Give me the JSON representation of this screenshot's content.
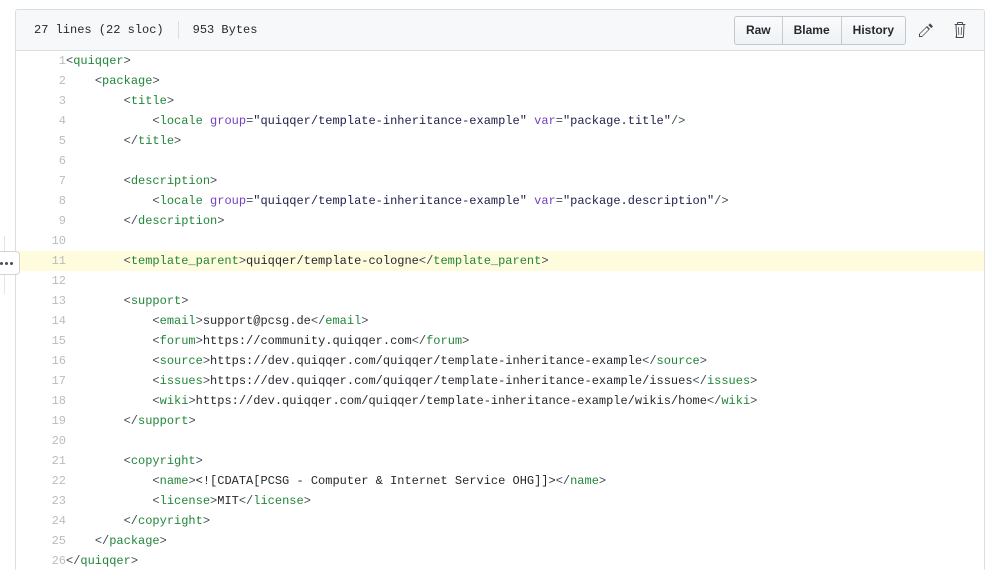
{
  "header": {
    "lines_info": "27 lines (22 sloc)",
    "size": "953 Bytes",
    "buttons": [
      {
        "label": "Raw",
        "name": "raw-button"
      },
      {
        "label": "Blame",
        "name": "blame-button"
      },
      {
        "label": "History",
        "name": "history-button"
      }
    ],
    "edit_icon": "pencil-icon",
    "delete_icon": "trash-icon"
  },
  "gutter_marker": {
    "icon": "kebab-dots-icon",
    "at_line": 11
  },
  "colors": {
    "tag": "#22863a",
    "attribute": "#6f42c1",
    "string": "#20224d",
    "bracket": "#3f4c55",
    "line_number": "#b9bdc2",
    "highlight": "#fffbdd",
    "header_bg": "#f6f8fa",
    "border": "#d8dee2"
  },
  "code": {
    "language": "xml",
    "highlighted_line": 11,
    "lines": [
      {
        "n": 1,
        "tokens": [
          {
            "t": "b",
            "v": "<"
          },
          {
            "t": "g",
            "v": "quiqqer"
          },
          {
            "t": "b",
            "v": ">"
          }
        ]
      },
      {
        "n": 2,
        "tokens": [
          {
            "t": "x",
            "v": "    "
          },
          {
            "t": "b",
            "v": "<"
          },
          {
            "t": "g",
            "v": "package"
          },
          {
            "t": "b",
            "v": ">"
          }
        ]
      },
      {
        "n": 3,
        "tokens": [
          {
            "t": "x",
            "v": "        "
          },
          {
            "t": "b",
            "v": "<"
          },
          {
            "t": "g",
            "v": "title"
          },
          {
            "t": "b",
            "v": ">"
          }
        ]
      },
      {
        "n": 4,
        "tokens": [
          {
            "t": "x",
            "v": "            "
          },
          {
            "t": "b",
            "v": "<"
          },
          {
            "t": "g",
            "v": "locale"
          },
          {
            "t": "x",
            "v": " "
          },
          {
            "t": "a",
            "v": "group"
          },
          {
            "t": "b",
            "v": "="
          },
          {
            "t": "s",
            "v": "\"quiqqer/template-inheritance-example\""
          },
          {
            "t": "x",
            "v": " "
          },
          {
            "t": "a",
            "v": "var"
          },
          {
            "t": "b",
            "v": "="
          },
          {
            "t": "s",
            "v": "\"package.title\""
          },
          {
            "t": "b",
            "v": "/>"
          }
        ]
      },
      {
        "n": 5,
        "tokens": [
          {
            "t": "x",
            "v": "        "
          },
          {
            "t": "b",
            "v": "</"
          },
          {
            "t": "g",
            "v": "title"
          },
          {
            "t": "b",
            "v": ">"
          }
        ]
      },
      {
        "n": 6,
        "tokens": []
      },
      {
        "n": 7,
        "tokens": [
          {
            "t": "x",
            "v": "        "
          },
          {
            "t": "b",
            "v": "<"
          },
          {
            "t": "g",
            "v": "description"
          },
          {
            "t": "b",
            "v": ">"
          }
        ]
      },
      {
        "n": 8,
        "tokens": [
          {
            "t": "x",
            "v": "            "
          },
          {
            "t": "b",
            "v": "<"
          },
          {
            "t": "g",
            "v": "locale"
          },
          {
            "t": "x",
            "v": " "
          },
          {
            "t": "a",
            "v": "group"
          },
          {
            "t": "b",
            "v": "="
          },
          {
            "t": "s",
            "v": "\"quiqqer/template-inheritance-example\""
          },
          {
            "t": "x",
            "v": " "
          },
          {
            "t": "a",
            "v": "var"
          },
          {
            "t": "b",
            "v": "="
          },
          {
            "t": "s",
            "v": "\"package.description\""
          },
          {
            "t": "b",
            "v": "/>"
          }
        ]
      },
      {
        "n": 9,
        "tokens": [
          {
            "t": "x",
            "v": "        "
          },
          {
            "t": "b",
            "v": "</"
          },
          {
            "t": "g",
            "v": "description"
          },
          {
            "t": "b",
            "v": ">"
          }
        ]
      },
      {
        "n": 10,
        "tokens": []
      },
      {
        "n": 11,
        "tokens": [
          {
            "t": "x",
            "v": "        "
          },
          {
            "t": "b",
            "v": "<"
          },
          {
            "t": "g",
            "v": "template_parent"
          },
          {
            "t": "b",
            "v": ">"
          },
          {
            "t": "x",
            "v": "quiqqer/template-cologne"
          },
          {
            "t": "b",
            "v": "</"
          },
          {
            "t": "g",
            "v": "template_parent"
          },
          {
            "t": "b",
            "v": ">"
          }
        ]
      },
      {
        "n": 12,
        "tokens": []
      },
      {
        "n": 13,
        "tokens": [
          {
            "t": "x",
            "v": "        "
          },
          {
            "t": "b",
            "v": "<"
          },
          {
            "t": "g",
            "v": "support"
          },
          {
            "t": "b",
            "v": ">"
          }
        ]
      },
      {
        "n": 14,
        "tokens": [
          {
            "t": "x",
            "v": "            "
          },
          {
            "t": "b",
            "v": "<"
          },
          {
            "t": "g",
            "v": "email"
          },
          {
            "t": "b",
            "v": ">"
          },
          {
            "t": "x",
            "v": "support@pcsg.de"
          },
          {
            "t": "b",
            "v": "</"
          },
          {
            "t": "g",
            "v": "email"
          },
          {
            "t": "b",
            "v": ">"
          }
        ]
      },
      {
        "n": 15,
        "tokens": [
          {
            "t": "x",
            "v": "            "
          },
          {
            "t": "b",
            "v": "<"
          },
          {
            "t": "g",
            "v": "forum"
          },
          {
            "t": "b",
            "v": ">"
          },
          {
            "t": "x",
            "v": "https://community.quiqqer.com"
          },
          {
            "t": "b",
            "v": "</"
          },
          {
            "t": "g",
            "v": "forum"
          },
          {
            "t": "b",
            "v": ">"
          }
        ]
      },
      {
        "n": 16,
        "tokens": [
          {
            "t": "x",
            "v": "            "
          },
          {
            "t": "b",
            "v": "<"
          },
          {
            "t": "g",
            "v": "source"
          },
          {
            "t": "b",
            "v": ">"
          },
          {
            "t": "x",
            "v": "https://dev.quiqqer.com/quiqqer/template-inheritance-example"
          },
          {
            "t": "b",
            "v": "</"
          },
          {
            "t": "g",
            "v": "source"
          },
          {
            "t": "b",
            "v": ">"
          }
        ]
      },
      {
        "n": 17,
        "tokens": [
          {
            "t": "x",
            "v": "            "
          },
          {
            "t": "b",
            "v": "<"
          },
          {
            "t": "g",
            "v": "issues"
          },
          {
            "t": "b",
            "v": ">"
          },
          {
            "t": "x",
            "v": "https://dev.quiqqer.com/quiqqer/template-inheritance-example/issues"
          },
          {
            "t": "b",
            "v": "</"
          },
          {
            "t": "g",
            "v": "issues"
          },
          {
            "t": "b",
            "v": ">"
          }
        ]
      },
      {
        "n": 18,
        "tokens": [
          {
            "t": "x",
            "v": "            "
          },
          {
            "t": "b",
            "v": "<"
          },
          {
            "t": "g",
            "v": "wiki"
          },
          {
            "t": "b",
            "v": ">"
          },
          {
            "t": "x",
            "v": "https://dev.quiqqer.com/quiqqer/template-inheritance-example/wikis/home"
          },
          {
            "t": "b",
            "v": "</"
          },
          {
            "t": "g",
            "v": "wiki"
          },
          {
            "t": "b",
            "v": ">"
          }
        ]
      },
      {
        "n": 19,
        "tokens": [
          {
            "t": "x",
            "v": "        "
          },
          {
            "t": "b",
            "v": "</"
          },
          {
            "t": "g",
            "v": "support"
          },
          {
            "t": "b",
            "v": ">"
          }
        ]
      },
      {
        "n": 20,
        "tokens": []
      },
      {
        "n": 21,
        "tokens": [
          {
            "t": "x",
            "v": "        "
          },
          {
            "t": "b",
            "v": "<"
          },
          {
            "t": "g",
            "v": "copyright"
          },
          {
            "t": "b",
            "v": ">"
          }
        ]
      },
      {
        "n": 22,
        "tokens": [
          {
            "t": "x",
            "v": "            "
          },
          {
            "t": "b",
            "v": "<"
          },
          {
            "t": "g",
            "v": "name"
          },
          {
            "t": "b",
            "v": ">"
          },
          {
            "t": "x",
            "v": "<![CDATA[PCSG - Computer & Internet Service OHG]]>"
          },
          {
            "t": "b",
            "v": "</"
          },
          {
            "t": "g",
            "v": "name"
          },
          {
            "t": "b",
            "v": ">"
          }
        ]
      },
      {
        "n": 23,
        "tokens": [
          {
            "t": "x",
            "v": "            "
          },
          {
            "t": "b",
            "v": "<"
          },
          {
            "t": "g",
            "v": "license"
          },
          {
            "t": "b",
            "v": ">"
          },
          {
            "t": "x",
            "v": "MIT"
          },
          {
            "t": "b",
            "v": "</"
          },
          {
            "t": "g",
            "v": "license"
          },
          {
            "t": "b",
            "v": ">"
          }
        ]
      },
      {
        "n": 24,
        "tokens": [
          {
            "t": "x",
            "v": "        "
          },
          {
            "t": "b",
            "v": "</"
          },
          {
            "t": "g",
            "v": "copyright"
          },
          {
            "t": "b",
            "v": ">"
          }
        ]
      },
      {
        "n": 25,
        "tokens": [
          {
            "t": "x",
            "v": "    "
          },
          {
            "t": "b",
            "v": "</"
          },
          {
            "t": "g",
            "v": "package"
          },
          {
            "t": "b",
            "v": ">"
          }
        ]
      },
      {
        "n": 26,
        "tokens": [
          {
            "t": "b",
            "v": "</"
          },
          {
            "t": "g",
            "v": "quiqqer"
          },
          {
            "t": "b",
            "v": ">"
          }
        ]
      }
    ]
  }
}
